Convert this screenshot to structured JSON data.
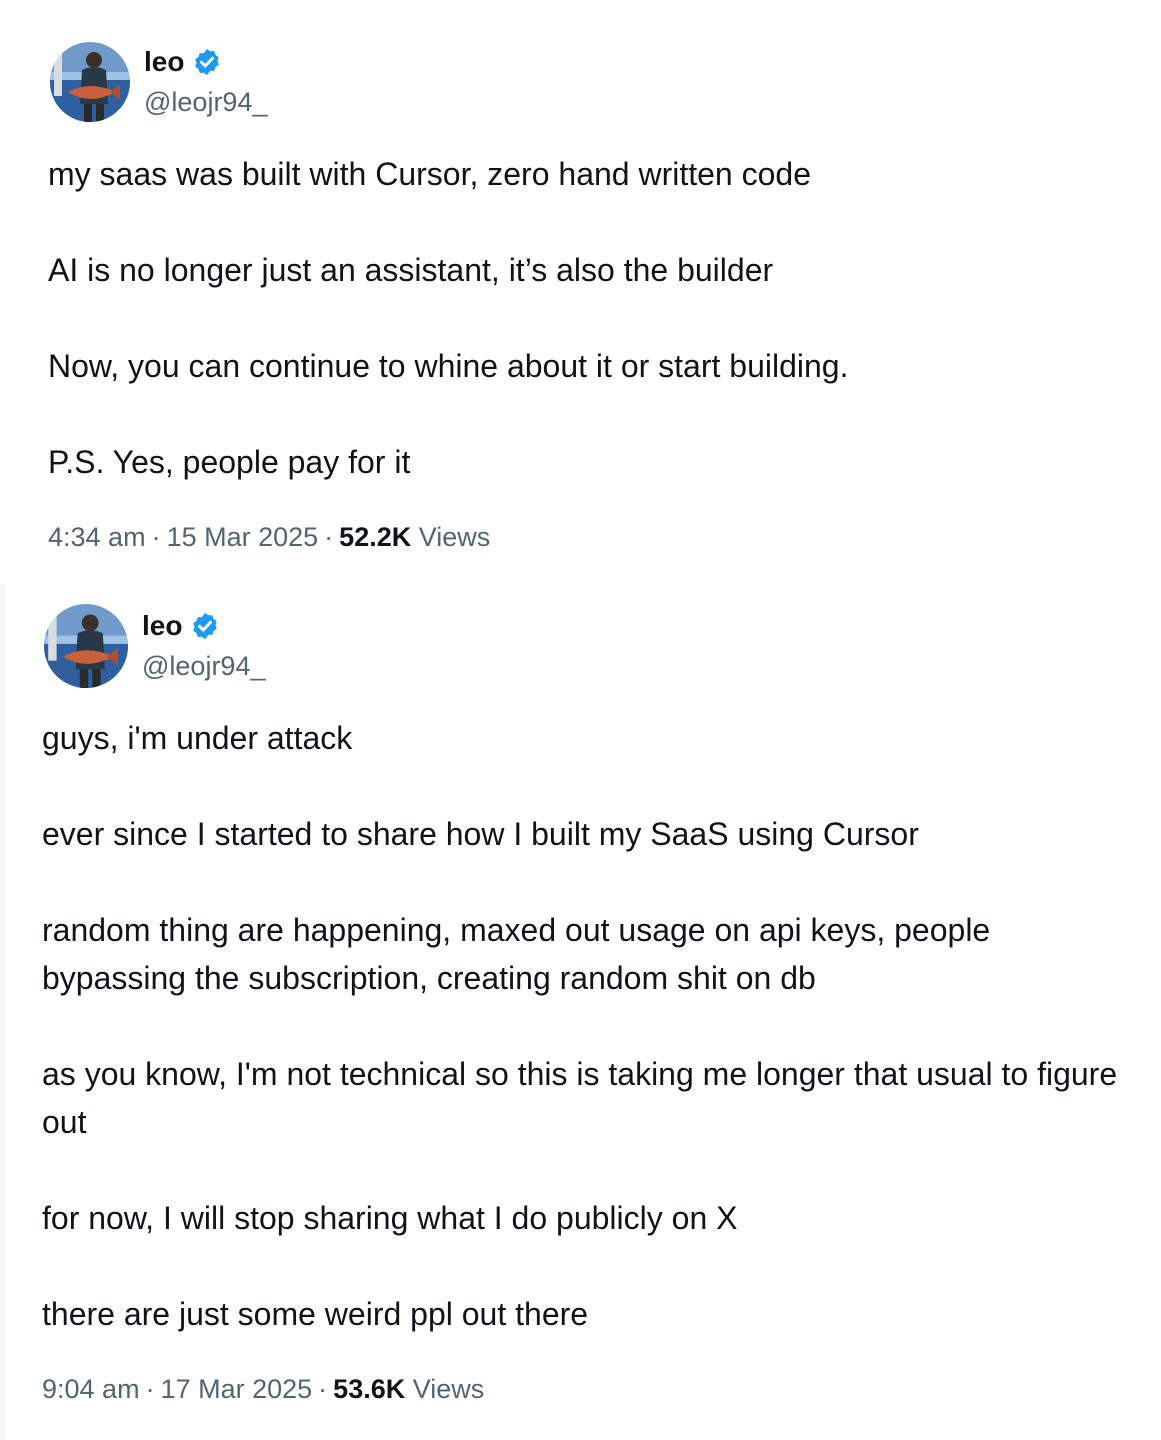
{
  "tweets": [
    {
      "author": {
        "display_name": "leo",
        "handle": "@leojr94_",
        "verified": true,
        "avatar_icon": "avatar-photo-fisherman"
      },
      "paragraphs": [
        "my saas was built with Cursor, zero hand written code",
        "AI is no longer just an assistant, it’s also the builder",
        "Now, you can continue to whine about it or start building.",
        "P.S. Yes, people pay for it"
      ],
      "time": "4:34 am",
      "date": "15 Mar 2025",
      "views_count": "52.2K",
      "views_label": "Views"
    },
    {
      "author": {
        "display_name": "leo",
        "handle": "@leojr94_",
        "verified": true,
        "avatar_icon": "avatar-photo-fisherman"
      },
      "paragraphs": [
        "guys, i'm under attack",
        "ever since I started to share how I built my SaaS using Cursor",
        "random thing are happening, maxed out usage on api keys, people bypassing the subscription, creating random shit on db",
        "as you know, I'm not technical so this is taking me longer that usual to figure out",
        "for now, I will stop sharing what I do publicly on X",
        "there are just some weird ppl out there"
      ],
      "time": "9:04 am",
      "date": "17 Mar 2025",
      "views_count": "53.6K",
      "views_label": "Views"
    }
  ],
  "colors": {
    "text": "#0f1419",
    "secondary": "#536471",
    "verified": "#1d9bf0"
  }
}
